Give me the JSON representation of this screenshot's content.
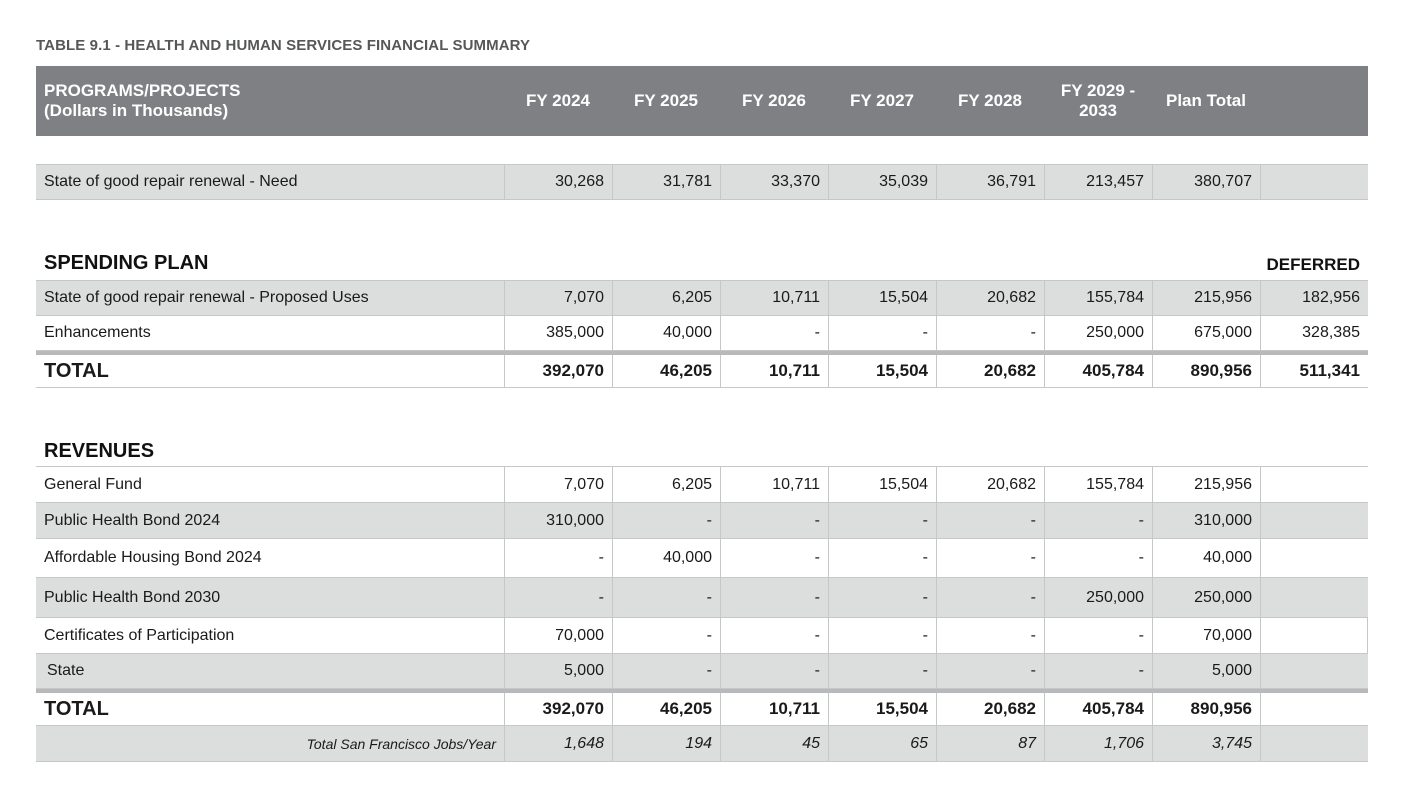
{
  "caption": "TABLE 9.1 - HEALTH AND HUMAN SERVICES FINANCIAL SUMMARY",
  "header": {
    "label_line1": "PROGRAMS/PROJECTS",
    "label_line2": "(Dollars in Thousands)",
    "cols": [
      "FY 2024",
      "FY 2025",
      "FY 2026",
      "FY 2027",
      "FY 2028"
    ],
    "col6_line1": "FY 2029 -",
    "col6_line2": "2033",
    "col7": "Plan Total"
  },
  "need_row": {
    "label": "State of good repair renewal - Need",
    "values": [
      "30,268",
      "31,781",
      "33,370",
      "35,039",
      "36,791",
      "213,457",
      "380,707"
    ]
  },
  "spending_plan": {
    "title": "SPENDING PLAN",
    "deferred_label": "DEFERRED",
    "rows": [
      {
        "label": "State of good repair renewal - Proposed Uses",
        "values": [
          "7,070",
          "6,205",
          "10,711",
          "15,504",
          "20,682",
          "155,784",
          "215,956",
          "182,956"
        ]
      },
      {
        "label": "Enhancements",
        "values": [
          "385,000",
          "40,000",
          "-",
          "-",
          "-",
          "250,000",
          "675,000",
          "328,385"
        ]
      }
    ],
    "total": {
      "label": "TOTAL",
      "values": [
        "392,070",
        "46,205",
        "10,711",
        "15,504",
        "20,682",
        "405,784",
        "890,956",
        "511,341"
      ]
    }
  },
  "revenues": {
    "title": "REVENUES",
    "rows": [
      {
        "label": "General Fund",
        "values": [
          "7,070",
          "6,205",
          "10,711",
          "15,504",
          "20,682",
          "155,784",
          "215,956"
        ]
      },
      {
        "label": "Public Health Bond 2024",
        "values": [
          "310,000",
          "-",
          "-",
          "-",
          "-",
          "-",
          "310,000"
        ]
      },
      {
        "label": "Affordable Housing Bond 2024",
        "values": [
          "-",
          "40,000",
          "-",
          "-",
          "-",
          "-",
          "40,000"
        ]
      },
      {
        "label": "Public Health Bond 2030",
        "values": [
          "-",
          "-",
          "-",
          "-",
          "-",
          "250,000",
          "250,000"
        ]
      },
      {
        "label": "Certificates of Participation",
        "values": [
          "70,000",
          "-",
          "-",
          "-",
          "-",
          "-",
          "70,000"
        ]
      },
      {
        "label": "State",
        "values": [
          "5,000",
          "-",
          "-",
          "-",
          "-",
          "-",
          "5,000"
        ]
      }
    ],
    "total": {
      "label": "TOTAL",
      "values": [
        "392,070",
        "46,205",
        "10,711",
        "15,504",
        "20,682",
        "405,784",
        "890,956"
      ]
    },
    "jobs": {
      "label": "Total San Francisco Jobs/Year",
      "values": [
        "1,648",
        "194",
        "45",
        "65",
        "87",
        "1,706",
        "3,745"
      ]
    }
  }
}
